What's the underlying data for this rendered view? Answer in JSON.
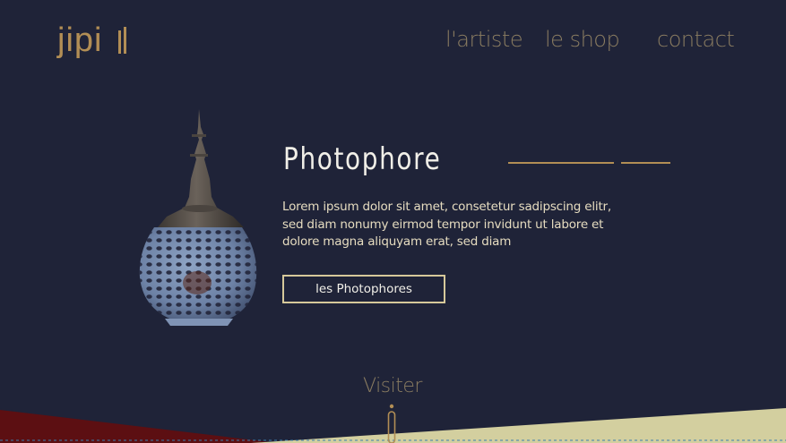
{
  "brand": {
    "logo_text": "jipi"
  },
  "nav": {
    "items": [
      "l'artiste",
      "le shop",
      "contact"
    ]
  },
  "hero": {
    "title": "Photophore",
    "description": "Lorem ipsum dolor sit amet, consetetur sadipscing elitr, sed diam nonumy eirmod tempor invidunt ut labore et dolore magna aliquyam erat, sed diam",
    "cta_label": "les Photophores"
  },
  "footer": {
    "visit_label": "Visiter"
  },
  "colors": {
    "background": "#1f2338",
    "accent_gold": "#b28e55",
    "cream": "#d3cf9f",
    "dark_red": "#5c0f12"
  }
}
